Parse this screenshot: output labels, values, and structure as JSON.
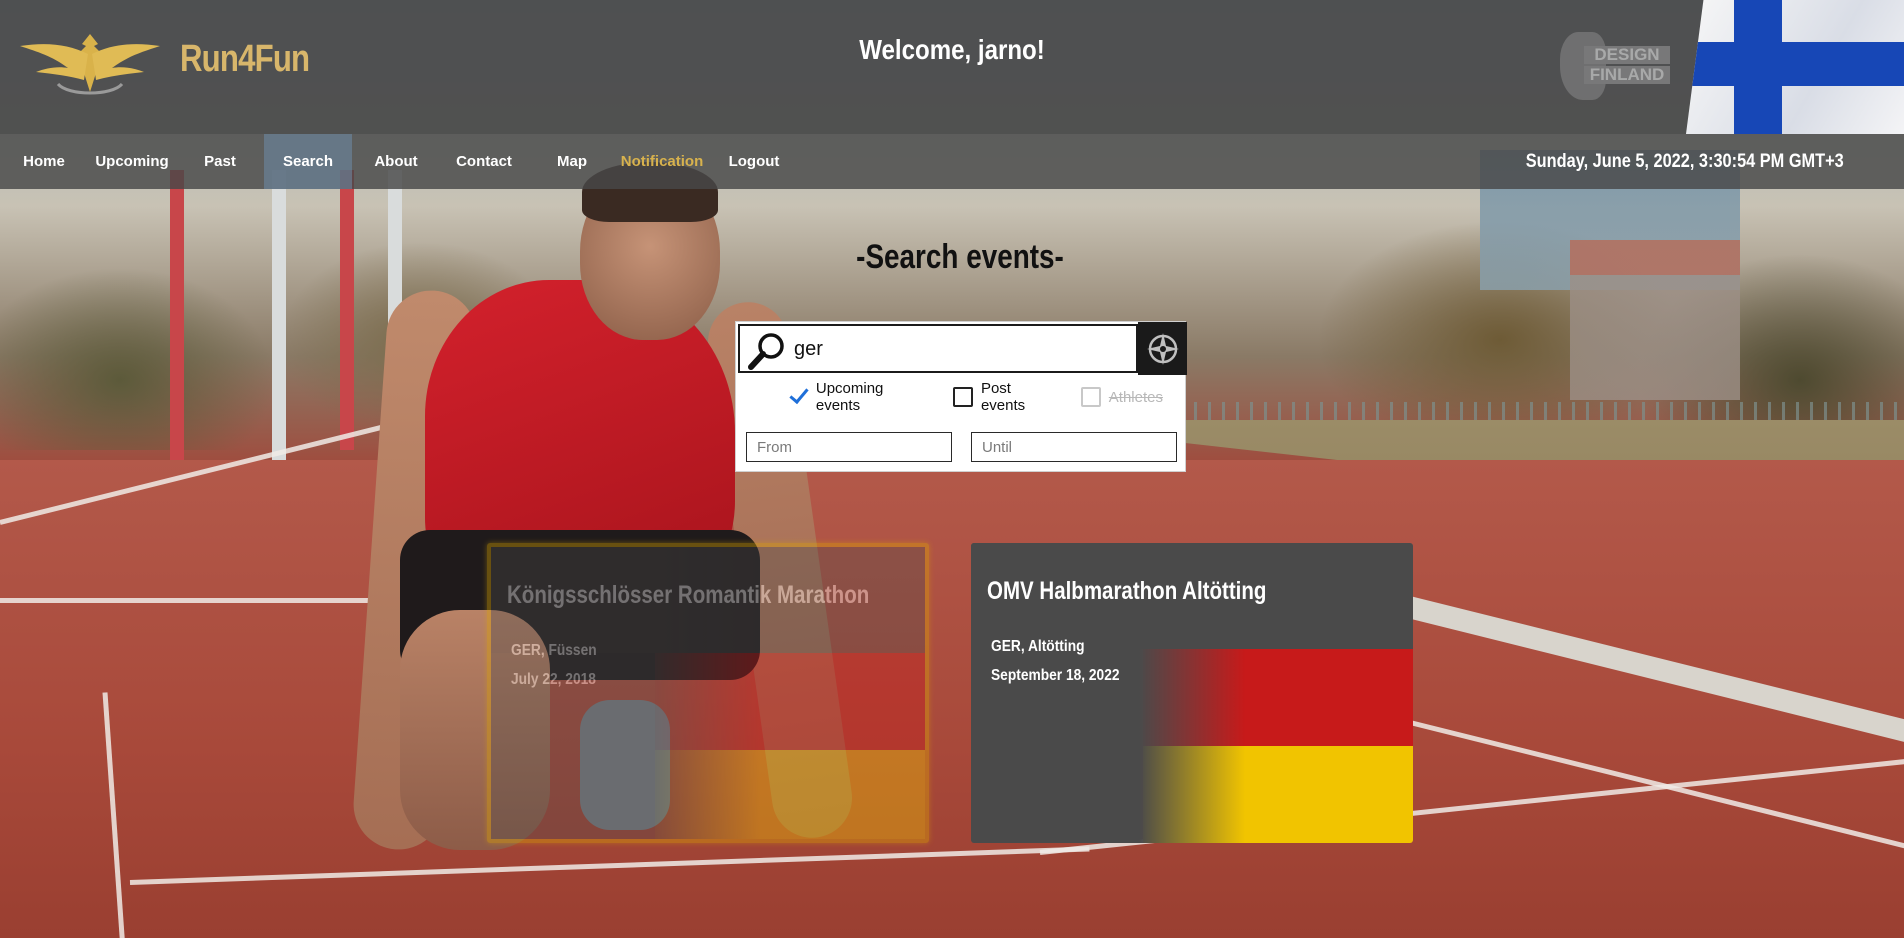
{
  "header": {
    "brand": "Run4Fun",
    "welcome": "Welcome, jarno!",
    "badge_line1": "DESIGN",
    "badge_line2": "FINLAND"
  },
  "nav": {
    "items": [
      {
        "label": "Home"
      },
      {
        "label": "Upcoming"
      },
      {
        "label": "Past"
      },
      {
        "label": "Search"
      },
      {
        "label": "About"
      },
      {
        "label": "Contact"
      },
      {
        "label": "Map"
      },
      {
        "label": "Notification"
      },
      {
        "label": "Logout"
      }
    ],
    "active": "Search",
    "clock": "Sunday, June 5, 2022, 3:30:54 PM GMT+3"
  },
  "search": {
    "title": "-Search events-",
    "query": "ger",
    "options": {
      "upcoming": {
        "label": "Upcoming events",
        "checked": true
      },
      "past": {
        "label": "Post events",
        "checked": false
      },
      "athletes": {
        "label": "Athletes",
        "disabled": true
      }
    },
    "from_placeholder": "From",
    "until_placeholder": "Until"
  },
  "results": [
    {
      "title": "Königsschlösser Romantik Marathon",
      "location": "GER, Füssen",
      "date": "July 22, 2018",
      "past": true
    },
    {
      "title": "OMV Halbmarathon Altötting",
      "location": "GER, Altötting",
      "date": "September 18, 2022",
      "past": false
    }
  ],
  "colors": {
    "brand_gold": "#d8b66b",
    "notification": "#d8b24d",
    "header_bg": "#484848",
    "checkbox_accent": "#1e6fd9",
    "past_highlight": "#e0a800"
  },
  "icons": {
    "logo": "eagle-logo-icon",
    "search": "magnifier-icon",
    "locate": "compass-icon",
    "flag": "finland-flag-icon"
  }
}
